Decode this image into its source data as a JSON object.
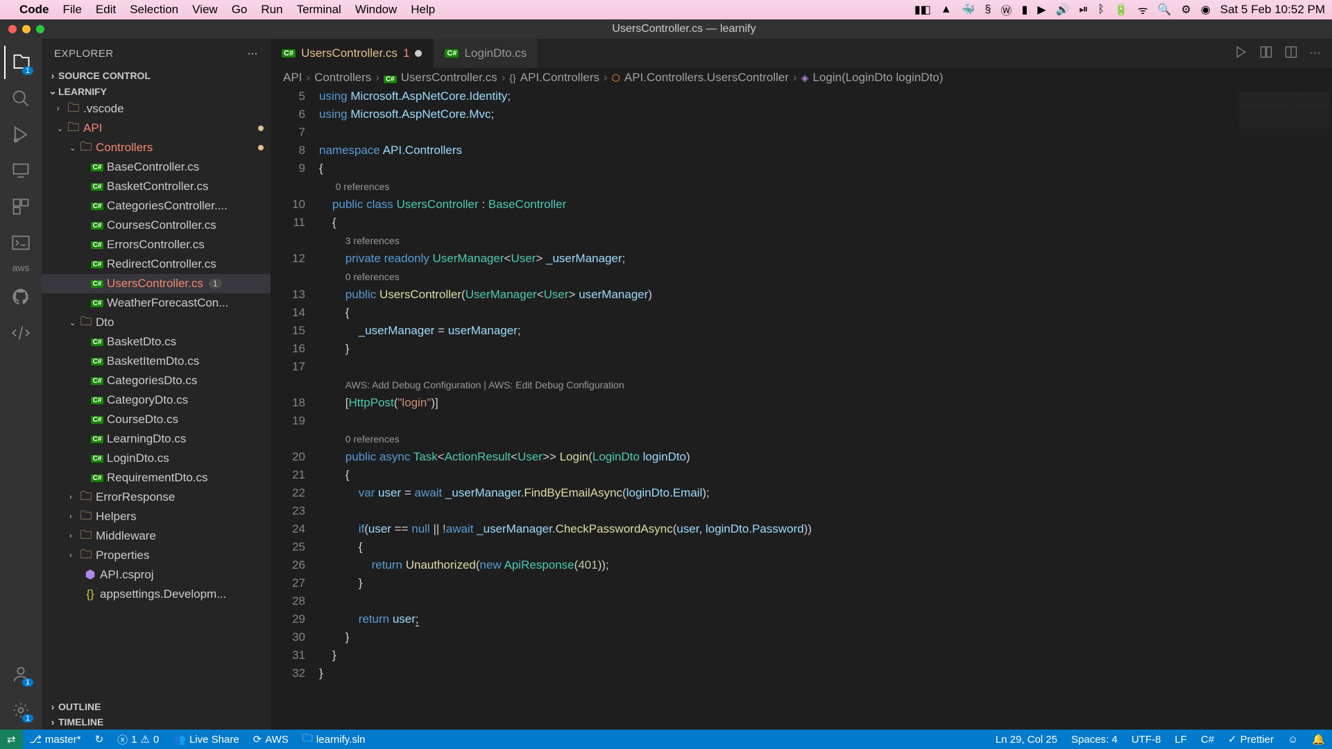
{
  "menubar": {
    "app_name": "Code",
    "items": [
      "File",
      "Edit",
      "Selection",
      "View",
      "Go",
      "Run",
      "Terminal",
      "Window",
      "Help"
    ],
    "clock": "Sat 5 Feb  10:52 PM"
  },
  "titlebar": {
    "title": "UsersController.cs — learnify"
  },
  "activitybar": {
    "explorer_badge": "1",
    "accounts_badge": "1",
    "settings_badge": "1",
    "aws_label": "aws"
  },
  "sidebar": {
    "title": "EXPLORER",
    "sections": {
      "source_control": "SOURCE CONTROL",
      "project": "LEARNIFY",
      "outline": "OUTLINE",
      "timeline": "TIMELINE"
    },
    "tree": {
      "vscode": ".vscode",
      "api": "API",
      "controllers": "Controllers",
      "files_controllers": [
        "BaseController.cs",
        "BasketController.cs",
        "CategoriesController....",
        "CoursesController.cs",
        "ErrorsController.cs",
        "RedirectController.cs",
        "UsersController.cs",
        "WeatherForecastCon..."
      ],
      "users_badge": "1",
      "dto": "Dto",
      "files_dto": [
        "BasketDto.cs",
        "BasketItemDto.cs",
        "CategoriesDto.cs",
        "CategoryDto.cs",
        "CourseDto.cs",
        "LearningDto.cs",
        "LoginDto.cs",
        "RequirementDto.cs"
      ],
      "folders_rest": [
        "ErrorResponse",
        "Helpers",
        "Middleware",
        "Properties"
      ],
      "api_csproj": "API.csproj",
      "appsettings": "appsettings.Developm..."
    }
  },
  "tabs": {
    "active": {
      "name": "UsersController.cs",
      "badge": "1"
    },
    "other": {
      "name": "LoginDto.cs"
    }
  },
  "breadcrumbs": [
    "API",
    "Controllers",
    "UsersController.cs",
    "API.Controllers",
    "API.Controllers.UsersController",
    "Login(LoginDto loginDto)"
  ],
  "code": {
    "lines": [
      5,
      6,
      7,
      8,
      9,
      10,
      11,
      12,
      13,
      14,
      15,
      16,
      17,
      18,
      19,
      20,
      22,
      23,
      24,
      25,
      26,
      27,
      28,
      29,
      30,
      31,
      32
    ],
    "l5": "using Microsoft.AspNetCore.Identity;",
    "l6": "using Microsoft.AspNetCore.Mvc;",
    "l8": "namespace API.Controllers",
    "ref0": "0 references",
    "ref3": "3 references",
    "aws_lens": "AWS: Add Debug Configuration | AWS: Edit Debug Configuration",
    "class_sig": "public class UsersController : BaseController",
    "field": "private readonly UserManager<User> _userManager;",
    "ctor": "public UsersController(UserManager<User> userManager)",
    "ctor_body": "_userManager = userManager;",
    "httppost": "[HttpPost(\"login\")]",
    "login_sig": "public async Task<ActionResult<User>> Login(LoginDto loginDto)",
    "findby": "var user = await _userManager.FindByEmailAsync(loginDto.Email);",
    "ifline": "if(user == null || !await _userManager.CheckPasswordAsync(user, loginDto.Password))",
    "unauth": "return Unauthorized(new ApiResponse(401));",
    "retuser": "return user;"
  },
  "statusbar": {
    "branch": "master*",
    "sync": "↻",
    "errors": "1",
    "warnings": "0",
    "live_share": "Live Share",
    "aws": "AWS",
    "solution": "learnify.sln",
    "cursor": "Ln 29, Col 25",
    "spaces": "Spaces: 4",
    "encoding": "UTF-8",
    "eol": "LF",
    "lang": "C#",
    "prettier": "Prettier"
  }
}
